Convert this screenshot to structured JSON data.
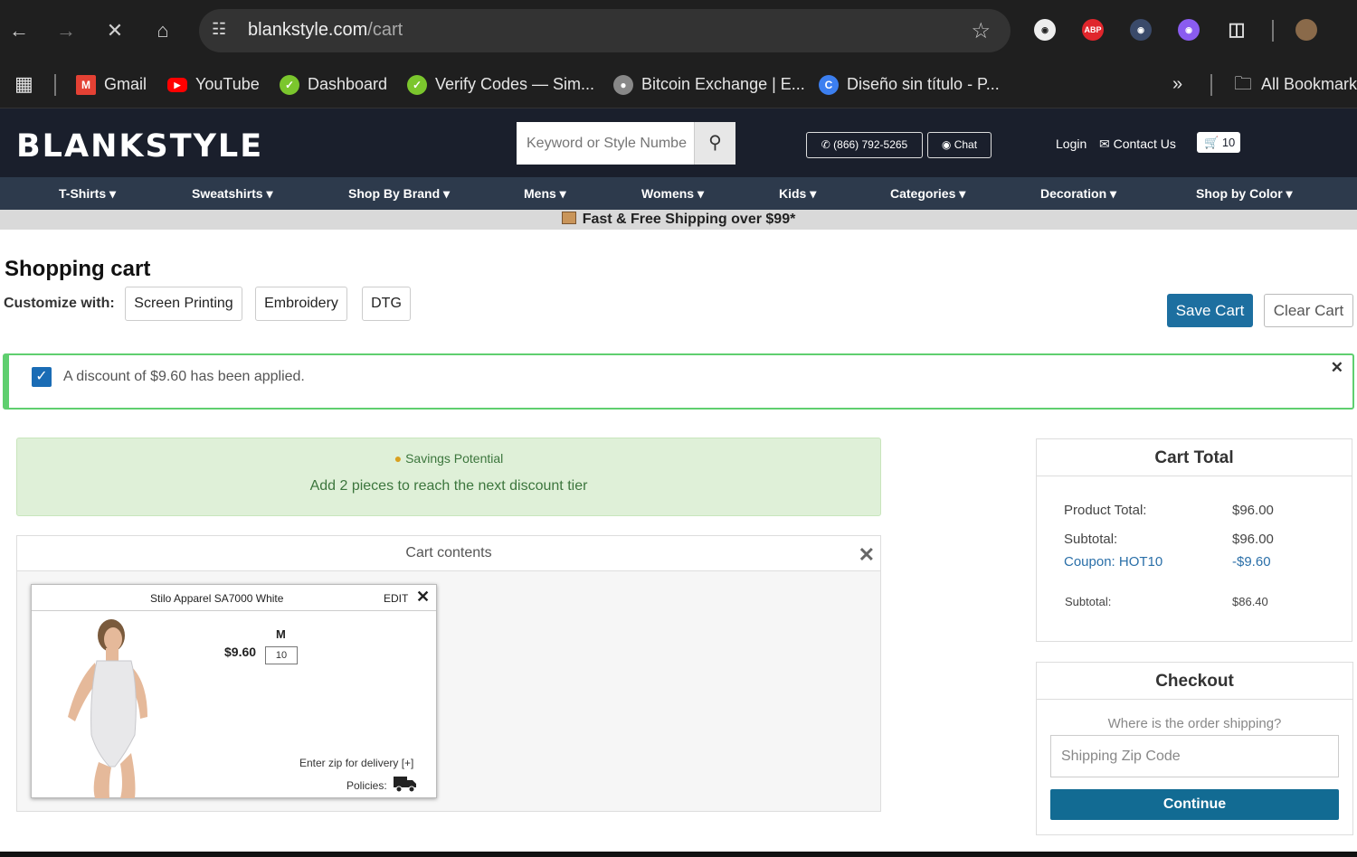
{
  "browser": {
    "url_domain": "blankstyle.com",
    "url_path": "/cart",
    "bookmarks": [
      {
        "label": "Gmail"
      },
      {
        "label": "YouTube"
      },
      {
        "label": "Dashboard"
      },
      {
        "label": "Verify Codes — Sim..."
      },
      {
        "label": "Bitcoin Exchange | E..."
      },
      {
        "label": "Diseño sin título - P..."
      }
    ],
    "all_bookmarks": "All Bookmarks",
    "extensions": [
      "ABP"
    ]
  },
  "site": {
    "logo": "BLANKSTYLE",
    "search_placeholder": "Keyword or Style Numbe",
    "phone": "(866) 792-5265",
    "chat": "Chat",
    "login": "Login",
    "contact": "Contact Us",
    "cart_count": "10",
    "nav": [
      "T-Shirts",
      "Sweatshirts",
      "Shop By Brand",
      "Mens",
      "Womens",
      "Kids",
      "Categories",
      "Decoration",
      "Shop by Color"
    ],
    "shipping_banner": "Fast & Free Shipping over $99*"
  },
  "cart": {
    "title": "Shopping cart",
    "customize_label": "Customize with:",
    "customize_options": [
      "Screen Printing",
      "Embroidery",
      "DTG"
    ],
    "save_label": "Save Cart",
    "clear_label": "Clear Cart",
    "alert": "A discount of $9.60 has been applied.",
    "savings_title": "Savings Potential",
    "savings_msg": "Add 2 pieces to reach the next discount tier",
    "contents_title": "Cart contents",
    "item": {
      "name": "Stilo Apparel SA7000 White",
      "edit": "EDIT",
      "price": "$9.60",
      "size": "M",
      "qty": "10",
      "zip_text": "Enter zip for delivery [+]",
      "policies": "Policies:"
    }
  },
  "totals": {
    "title": "Cart Total",
    "product_total_label": "Product Total:",
    "product_total": "$96.00",
    "subtotal_label": "Subtotal:",
    "subtotal": "$96.00",
    "coupon_label": "Coupon: HOT10",
    "coupon": "-$9.60",
    "final_label": "Subtotal:",
    "final": "$86.40"
  },
  "checkout": {
    "title": "Checkout",
    "question": "Where is the order shipping?",
    "zip_placeholder": "Shipping Zip Code",
    "continue": "Continue"
  }
}
